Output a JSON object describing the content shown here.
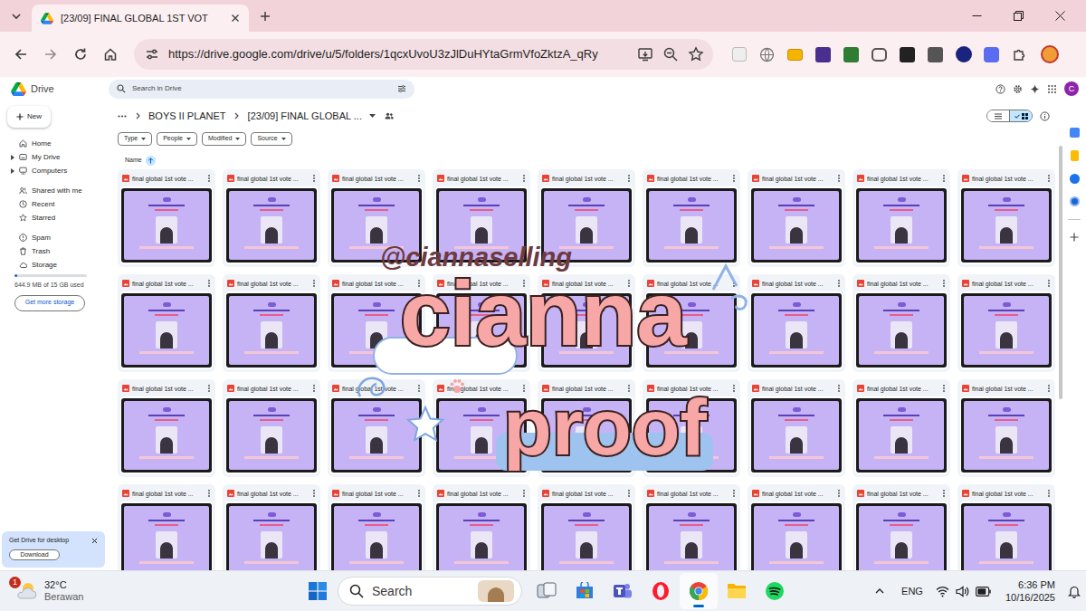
{
  "browser": {
    "tab": {
      "title": "[23/09] FINAL GLOBAL 1ST VOT",
      "selected": true
    },
    "url": "https://drive.google.com/drive/u/5/folders/1qcxUvoU3zJlDuHYtaGrmVfoZktzA_qRy"
  },
  "drive": {
    "logo": "Drive",
    "search": {
      "placeholder": "Search in Drive"
    },
    "avatar": "C",
    "new_button": "New",
    "nav": [
      [
        {
          "label": "Home",
          "kind": "link",
          "selected": false
        },
        {
          "label": "My Drive",
          "kind": "tree",
          "selected": false
        },
        {
          "label": "Computers",
          "kind": "tree",
          "selected": false
        }
      ],
      [
        {
          "label": "Shared with me",
          "kind": "link",
          "selected": false
        },
        {
          "label": "Recent",
          "kind": "link",
          "selected": false
        },
        {
          "label": "Starred",
          "kind": "link",
          "selected": false
        }
      ],
      [
        {
          "label": "Spam",
          "kind": "link",
          "selected": false
        },
        {
          "label": "Trash",
          "kind": "link",
          "selected": false
        },
        {
          "label": "Storage",
          "kind": "link",
          "selected": false
        }
      ]
    ],
    "storage": {
      "level": 0.043,
      "text": "644.9 MB of 15 GB used",
      "button": "Get more storage"
    },
    "breadcrumb": [
      "BOYS II PLANET",
      "[23/09] FINAL GLOBAL ..."
    ],
    "filters": [
      "Type",
      "People",
      "Modified",
      "Source"
    ],
    "sort": {
      "label": "Name"
    },
    "view": [
      {
        "kind": "list",
        "selected": false
      },
      {
        "kind": "grid",
        "selected": true
      }
    ],
    "files": [
      {
        "name": "final global 1st vote ..."
      },
      {
        "name": "final global 1st vote ..."
      },
      {
        "name": "final global 1st vote ..."
      },
      {
        "name": "final global 1st vote ..."
      },
      {
        "name": "final global 1st vote ..."
      },
      {
        "name": "final global 1st vote ..."
      },
      {
        "name": "final global 1st vote ..."
      },
      {
        "name": "final global 1st vote ..."
      },
      {
        "name": "final global 1st vote ..."
      },
      {
        "name": "final global 1st vote ..."
      },
      {
        "name": "final global 1st vote ..."
      },
      {
        "name": "final global 1st vote ..."
      },
      {
        "name": "final global 1st vote ..."
      },
      {
        "name": "final global 1st vote ..."
      },
      {
        "name": "final global 1st vote ..."
      },
      {
        "name": "final global 1st vote ..."
      },
      {
        "name": "final global 1st vote ..."
      },
      {
        "name": "final global 1st vote ..."
      },
      {
        "name": "final global 1st vote ..."
      },
      {
        "name": "final global 1st vote ..."
      },
      {
        "name": "final global 1st vote ..."
      },
      {
        "name": "final global 1st vote ..."
      },
      {
        "name": "final global 1st vote ..."
      },
      {
        "name": "final global 1st vote ..."
      },
      {
        "name": "final global 1st vote ..."
      },
      {
        "name": "final global 1st vote ..."
      },
      {
        "name": "final global 1st vote ..."
      },
      {
        "name": "final global 1st vote ..."
      },
      {
        "name": "final global 1st vote ..."
      },
      {
        "name": "final global 1st vote ..."
      },
      {
        "name": "final global 1st vote ..."
      },
      {
        "name": "final global 1st vote ..."
      },
      {
        "name": "final global 1st vote ..."
      },
      {
        "name": "final global 1st vote ..."
      },
      {
        "name": "final global 1st vote ..."
      },
      {
        "name": "final global 1st vote ..."
      }
    ],
    "promo": {
      "title": "Get Drive for desktop",
      "button": "Download"
    }
  },
  "watermark": {
    "handle": "@ciannaselling",
    "title": "cianna",
    "label": "proof"
  },
  "taskbar": {
    "weather": {
      "temp": "32°C",
      "desc": "Berawan",
      "badge": "1"
    },
    "search": "Search",
    "apps": [
      {
        "kind": "taskview",
        "active": false
      },
      {
        "kind": "store",
        "active": false
      },
      {
        "kind": "teams",
        "active": false
      },
      {
        "kind": "opera",
        "active": false
      },
      {
        "kind": "chrome",
        "active": true
      },
      {
        "kind": "explorer",
        "active": false
      },
      {
        "kind": "spotify",
        "active": false
      }
    ],
    "lang": "ENG",
    "time": "6:36 PM",
    "date": "10/16/2025"
  }
}
